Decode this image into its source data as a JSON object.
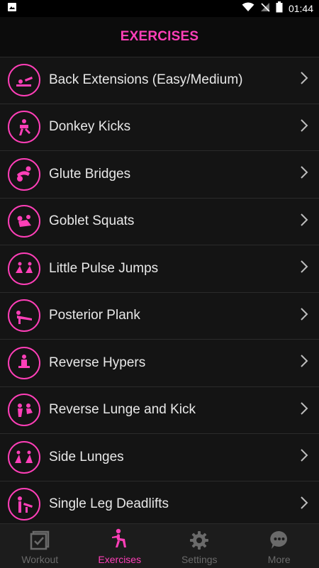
{
  "status_bar": {
    "time": "01:44"
  },
  "header": {
    "title": "EXERCISES"
  },
  "exercises": [
    {
      "label": "Back Extensions (Easy/Medium)"
    },
    {
      "label": "Donkey Kicks"
    },
    {
      "label": "Glute Bridges"
    },
    {
      "label": "Goblet Squats"
    },
    {
      "label": "Little Pulse Jumps"
    },
    {
      "label": "Posterior Plank"
    },
    {
      "label": "Reverse Hypers"
    },
    {
      "label": "Reverse Lunge and Kick"
    },
    {
      "label": "Side Lunges"
    },
    {
      "label": "Single Leg Deadlifts"
    }
  ],
  "tabs": [
    {
      "label": "Workout",
      "icon": "workout-checkbox-icon",
      "active": false
    },
    {
      "label": "Exercises",
      "icon": "squat-figure-icon",
      "active": true
    },
    {
      "label": "Settings",
      "icon": "gear-icon",
      "active": false
    },
    {
      "label": "More",
      "icon": "chat-bubble-icon",
      "active": false
    }
  ],
  "colors": {
    "accent": "#ff3fb8",
    "background": "#141414",
    "tab_inactive": "#6a6a6a"
  }
}
